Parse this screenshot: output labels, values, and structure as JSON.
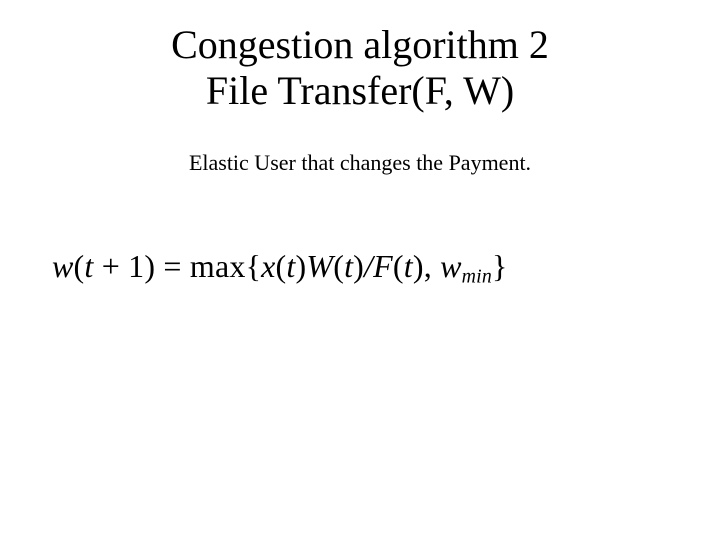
{
  "title_line1": "Congestion algorithm 2",
  "title_line2": "File Transfer(F, W)",
  "subtitle": "Elastic User that changes the Payment.",
  "equation": {
    "lhs_var": "w",
    "lhs_arg_open": "(",
    "lhs_t": "t",
    "lhs_plus": " + ",
    "lhs_one": "1",
    "lhs_arg_close": ") = ",
    "max": "max",
    "brace_open": "{",
    "x": "x",
    "xt_open": "(",
    "xt_t": "t",
    "xt_close": ")",
    "W": "W",
    "Wt_open": "(",
    "Wt_t": "t",
    "Wt_close": ")",
    "slash": "/",
    "F": "F",
    "Ft_open": "(",
    "Ft_t": "t",
    "Ft_close": ")",
    "comma": ", ",
    "wmin_w": "w",
    "wmin_sub": "min",
    "brace_close": "}"
  }
}
